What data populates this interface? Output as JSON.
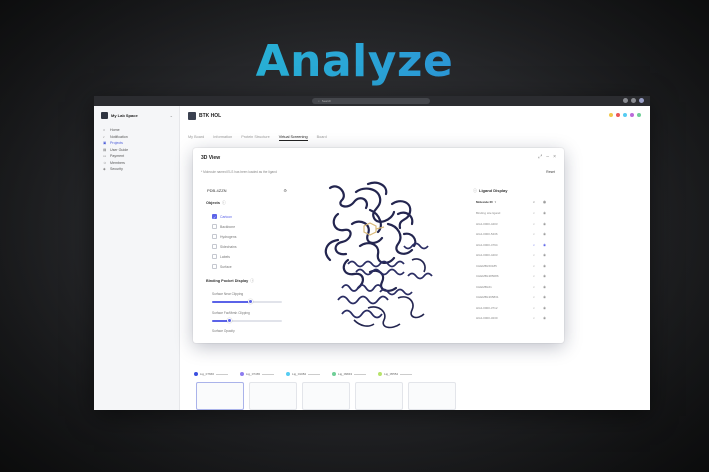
{
  "hero": {
    "title": "Analyze"
  },
  "titlebar": {
    "search_placeholder": "Search"
  },
  "sidebar": {
    "workspace": "My Lab Space",
    "items": [
      {
        "label": "Home",
        "icon": "home-icon",
        "active": false
      },
      {
        "label": "Notification",
        "icon": "bell-icon",
        "active": false
      },
      {
        "label": "Projects",
        "icon": "folder-icon",
        "active": true
      },
      {
        "label": "User Guide",
        "icon": "book-icon",
        "active": false
      },
      {
        "label": "Payment",
        "icon": "card-icon",
        "active": false
      },
      {
        "label": "Members",
        "icon": "users-icon",
        "active": false
      },
      {
        "label": "Security",
        "icon": "shield-icon",
        "active": false
      }
    ]
  },
  "project": {
    "name": "BTK HOL",
    "tabs": [
      "My Board",
      "Information",
      "Protein Structure",
      "Virtual Screening",
      "Board"
    ],
    "active_tab": 3,
    "member_colors": [
      "#f2c94c",
      "#eb5757",
      "#56ccf2",
      "#bb6bd9",
      "#6fcf97"
    ]
  },
  "modal": {
    "title": "3D View",
    "note": "* Molecule named ELS has been loaded as the ligand",
    "reset_label": "Reset",
    "pdb_id": "PDB-4ZZN",
    "objects_title": "Objects",
    "objects": [
      {
        "label": "Cartoon",
        "checked": true
      },
      {
        "label": "Backbone",
        "checked": false
      },
      {
        "label": "Hydrogens",
        "checked": false
      },
      {
        "label": "Sidechains",
        "checked": false
      },
      {
        "label": "Labels",
        "checked": false
      },
      {
        "label": "Surface",
        "checked": false
      }
    ],
    "binding_title": "Binding Pocket Display",
    "sliders": [
      {
        "label": "Surface Near Clipping",
        "value": 0.55
      },
      {
        "label": "Surface Far/Mesh Clipping",
        "value": 0.25
      }
    ],
    "opacity_label": "Surface Opacity",
    "ligand_title": "Ligand Display",
    "ligand_header": "Molecule ID",
    "ligands": [
      {
        "id": "Binding site ligand",
        "focus": false,
        "visible": false
      },
      {
        "id": "HG2-0000-4403",
        "focus": false,
        "visible": false
      },
      {
        "id": "HG2-0000-5436",
        "focus": false,
        "visible": false
      },
      {
        "id": "HG2-0000-4794",
        "focus": true,
        "visible": true
      },
      {
        "id": "HG2-0000-4403",
        "focus": false,
        "visible": false
      },
      {
        "id": "CHEMBL50185",
        "focus": false,
        "visible": false
      },
      {
        "id": "CHEMBL385086",
        "focus": false,
        "visible": false
      },
      {
        "id": "CHEMBL61",
        "focus": false,
        "visible": false
      },
      {
        "id": "CHEMBL395831",
        "focus": false,
        "visible": false
      },
      {
        "id": "HG2-0000-3712",
        "focus": false,
        "visible": false
      },
      {
        "id": "HG2-0000-3230",
        "focus": false,
        "visible": false
      }
    ]
  },
  "ligand_bar": [
    {
      "label": "Lig_07666",
      "color": "#3b4fe0"
    },
    {
      "label": "Lig_07465",
      "color": "#8d7cf0"
    },
    {
      "label": "Lig_01084",
      "color": "#56ccf2"
    },
    {
      "label": "Lig_09843",
      "color": "#6fcf97"
    },
    {
      "label": "Lig_05554",
      "color": "#b7e36b"
    }
  ]
}
